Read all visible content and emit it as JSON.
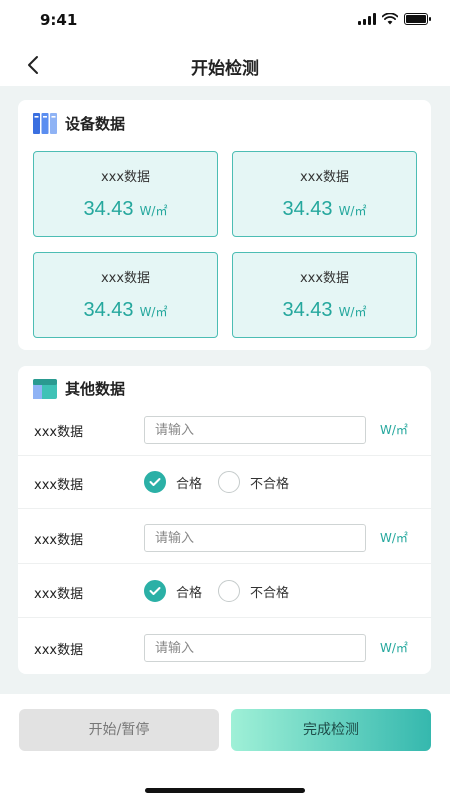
{
  "status_bar": {
    "time": "9:41"
  },
  "nav": {
    "title": "开始检测"
  },
  "device_section": {
    "title": "设备数据",
    "metrics": [
      {
        "label": "xxx数据",
        "value": "34.43",
        "unit": "W/㎡"
      },
      {
        "label": "xxx数据",
        "value": "34.43",
        "unit": "W/㎡"
      },
      {
        "label": "xxx数据",
        "value": "34.43",
        "unit": "W/㎡"
      },
      {
        "label": "xxx数据",
        "value": "34.43",
        "unit": "W/㎡"
      }
    ]
  },
  "other_section": {
    "title": "其他数据",
    "rows": [
      {
        "label": "xxx数据",
        "placeholder": "请输入",
        "unit": "W/㎡"
      },
      {
        "label": "xxx数据",
        "option_pass": "合格",
        "option_fail": "不合格",
        "selected": "合格"
      },
      {
        "label": "xxx数据",
        "placeholder": "请输入",
        "unit": "W/㎡"
      },
      {
        "label": "xxx数据",
        "option_pass": "合格",
        "option_fail": "不合格",
        "selected": "合格"
      },
      {
        "label": "xxx数据",
        "placeholder": "请输入",
        "unit": "W/㎡"
      }
    ]
  },
  "actions": {
    "pause_label": "开始/暂停",
    "finish_label": "完成检测"
  },
  "colors": {
    "accent": "#2bb0a6",
    "metric_bg": "#e5f6f5",
    "metric_border": "#4cbdb4",
    "page_bg": "#eef3f3"
  },
  "icons": {
    "back": "chevron-left-icon",
    "device_section": "books-icon",
    "other_section": "table-icon",
    "selected": "checkmark-icon"
  }
}
